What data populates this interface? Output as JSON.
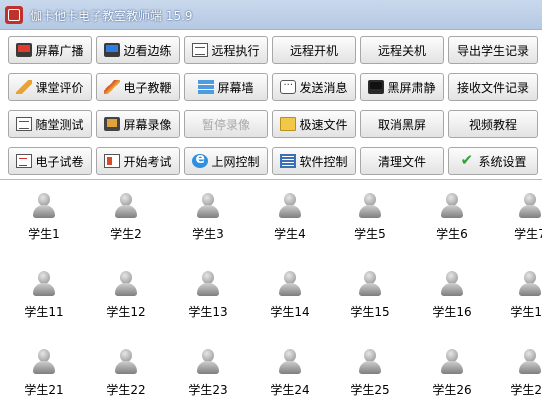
{
  "window": {
    "title": "伽卡他卡电子教室教师端 15.9"
  },
  "toolbar": {
    "row1": [
      {
        "label": "屏幕广播",
        "icon": "monitor-red-icon"
      },
      {
        "label": "边看边练",
        "icon": "monitor-blue-icon"
      },
      {
        "label": "远程执行",
        "icon": "form-icon"
      },
      {
        "label": "远程开机",
        "icon": ""
      },
      {
        "label": "远程关机",
        "icon": ""
      },
      {
        "label": "导出学生记录",
        "icon": ""
      }
    ],
    "row2": [
      {
        "label": "课堂评价",
        "icon": "pencil-icon"
      },
      {
        "label": "电子教鞭",
        "icon": "pen-icon"
      },
      {
        "label": "屏幕墙",
        "icon": "wall-icon"
      },
      {
        "label": "发送消息",
        "icon": "chat-icon"
      },
      {
        "label": "黑屏肃静",
        "icon": "monitor-dark-icon"
      },
      {
        "label": "接收文件记录",
        "icon": ""
      }
    ],
    "row3": [
      {
        "label": "随堂测试",
        "icon": "form-icon"
      },
      {
        "label": "屏幕录像",
        "icon": "video-icon"
      },
      {
        "label": "暂停录像",
        "icon": "",
        "disabled": true
      },
      {
        "label": "极速文件",
        "icon": "folder-icon"
      },
      {
        "label": "取消黑屏",
        "icon": ""
      },
      {
        "label": "视频教程",
        "icon": ""
      }
    ],
    "row4": [
      {
        "label": "电子试卷",
        "icon": "paper-icon"
      },
      {
        "label": "开始考试",
        "icon": "book-icon"
      },
      {
        "label": "上网控制",
        "icon": "ie-icon"
      },
      {
        "label": "软件控制",
        "icon": "grid-icon"
      },
      {
        "label": "清理文件",
        "icon": ""
      },
      {
        "label": "系统设置",
        "icon": "check-icon"
      }
    ]
  },
  "students": [
    "学生1",
    "学生2",
    "学生3",
    "学生4",
    "学生5",
    "学生6",
    "学生7",
    "学生11",
    "学生12",
    "学生13",
    "学生14",
    "学生15",
    "学生16",
    "学生17",
    "学生21",
    "学生22",
    "学生23",
    "学生24",
    "学生25",
    "学生26",
    "学生27"
  ]
}
